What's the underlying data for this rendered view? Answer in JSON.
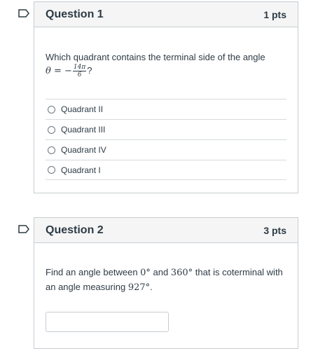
{
  "questions": [
    {
      "title": "Question 1",
      "points": "1 pts",
      "text_before": "Which quadrant contains the terminal side of the angle",
      "math_prefix": "θ = −",
      "frac_num": "14π",
      "frac_den": "6",
      "math_suffix": "?",
      "answers": [
        "Quadrant II",
        "Quadrant III",
        "Quadrant IV",
        "Quadrant I"
      ]
    },
    {
      "title": "Question 2",
      "points": "3 pts",
      "text_a": "Find an angle between ",
      "math_a": "0°",
      "text_b": " and ",
      "math_b": "360°",
      "text_c": " that is coterminal with an angle measuring ",
      "math_c": "927°",
      "text_d": ".",
      "input_value": ""
    }
  ],
  "colors": {
    "border": "#c7cdd1",
    "header_bg": "#f5f5f5",
    "text": "#2d3b45"
  }
}
